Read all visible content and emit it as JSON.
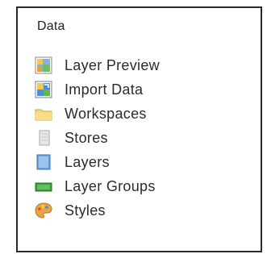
{
  "panel": {
    "heading": "Data",
    "items": [
      {
        "label": "Layer Preview",
        "icon": "layer-preview-icon"
      },
      {
        "label": "Import Data",
        "icon": "import-data-icon"
      },
      {
        "label": "Workspaces",
        "icon": "folder-icon"
      },
      {
        "label": "Stores",
        "icon": "database-icon"
      },
      {
        "label": "Layers",
        "icon": "layer-icon"
      },
      {
        "label": "Layer Groups",
        "icon": "layer-group-icon"
      },
      {
        "label": "Styles",
        "icon": "palette-icon"
      }
    ]
  }
}
